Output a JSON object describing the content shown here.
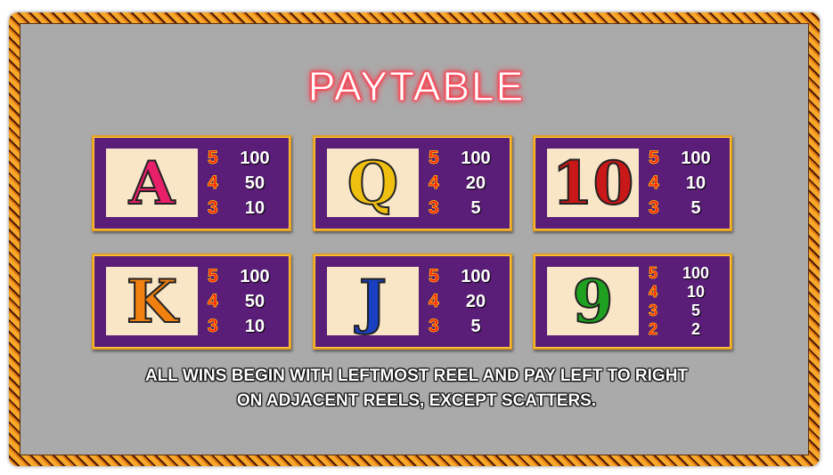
{
  "title": "PAYTABLE",
  "symbols": [
    {
      "name": "A",
      "color": "#e8206a",
      "pays": [
        {
          "count": "5",
          "pay": "100"
        },
        {
          "count": "4",
          "pay": "50"
        },
        {
          "count": "3",
          "pay": "10"
        }
      ]
    },
    {
      "name": "Q",
      "color": "#f0c010",
      "pays": [
        {
          "count": "5",
          "pay": "100"
        },
        {
          "count": "4",
          "pay": "20"
        },
        {
          "count": "3",
          "pay": "5"
        }
      ]
    },
    {
      "name": "10",
      "color": "#c81818",
      "pays": [
        {
          "count": "5",
          "pay": "100"
        },
        {
          "count": "4",
          "pay": "10"
        },
        {
          "count": "3",
          "pay": "5"
        }
      ]
    },
    {
      "name": "K",
      "color": "#f08010",
      "pays": [
        {
          "count": "5",
          "pay": "100"
        },
        {
          "count": "4",
          "pay": "50"
        },
        {
          "count": "3",
          "pay": "10"
        }
      ]
    },
    {
      "name": "J",
      "color": "#1840c0",
      "pays": [
        {
          "count": "5",
          "pay": "100"
        },
        {
          "count": "4",
          "pay": "20"
        },
        {
          "count": "3",
          "pay": "5"
        }
      ]
    },
    {
      "name": "9",
      "color": "#20a020",
      "pays": [
        {
          "count": "5",
          "pay": "100"
        },
        {
          "count": "4",
          "pay": "10"
        },
        {
          "count": "3",
          "pay": "5"
        },
        {
          "count": "2",
          "pay": "2"
        }
      ]
    }
  ],
  "note": [
    "ALL WINS BEGIN WITH LEFTMOST REEL AND PAY LEFT TO RIGHT",
    "ON ADJACENT REELS, EXCEPT SCATTERS."
  ]
}
